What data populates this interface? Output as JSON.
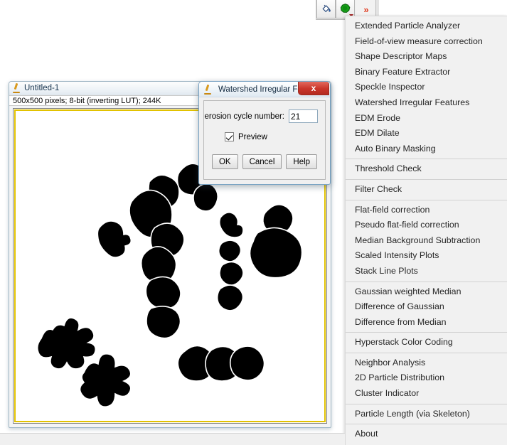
{
  "toolbar": {
    "buttons": [
      {
        "name": "fill-bucket-icon",
        "label": ""
      },
      {
        "name": "particle-plugin-icon",
        "label": ""
      },
      {
        "name": "more-tools-icon",
        "label": "»"
      }
    ]
  },
  "image_window": {
    "title": "Untitled-1",
    "status": "500x500 pixels; 8-bit (inverting LUT); 244K",
    "icon": "imagej-microscope-icon"
  },
  "dialog": {
    "title": "Watershed Irregular Fe...",
    "icon": "imagej-microscope-icon",
    "close_label": "x",
    "field_label": "erosion cycle number:",
    "field_value": "21",
    "checkbox_label": "Preview",
    "checkbox_checked": true,
    "buttons": [
      {
        "name": "ok-button",
        "label": "OK"
      },
      {
        "name": "cancel-button",
        "label": "Cancel"
      },
      {
        "name": "help-button",
        "label": "Help"
      }
    ]
  },
  "menu": {
    "groups": [
      {
        "items": [
          "Extended Particle Analyzer",
          "Field-of-view measure correction",
          "Shape Descriptor Maps",
          "Binary Feature Extractor",
          "Speckle Inspector",
          "Watershed Irregular Features",
          "EDM Erode",
          "EDM Dilate",
          "Auto Binary Masking"
        ]
      },
      {
        "items": [
          "Threshold Check"
        ]
      },
      {
        "items": [
          "Filter Check"
        ]
      },
      {
        "items": [
          "Flat-field correction",
          "Pseudo flat-field correction",
          "Median Background Subtraction",
          "Scaled Intensity Plots",
          "Stack Line Plots"
        ]
      },
      {
        "items": [
          "Gaussian weighted Median",
          "Difference of Gaussian",
          "Difference from Median"
        ]
      },
      {
        "items": [
          "Hyperstack Color Coding"
        ]
      },
      {
        "items": [
          "Neighbor Analysis",
          "2D Particle Distribution",
          "Cluster Indicator"
        ]
      },
      {
        "items": [
          "Particle Length (via Skeleton)"
        ]
      },
      {
        "items": [
          "About"
        ]
      }
    ]
  },
  "colors": {
    "menu_bg": "#f1f1f1",
    "menu_text": "#262626",
    "canvas_border_active": "#e2c200",
    "close_button": "#c9352a",
    "particle_fill": "#000000",
    "canvas_bg": "#ffffff"
  }
}
